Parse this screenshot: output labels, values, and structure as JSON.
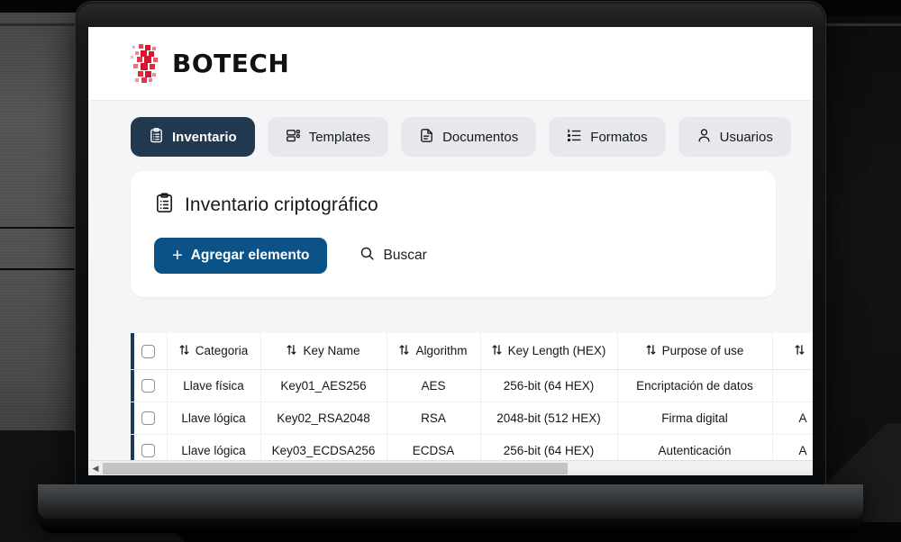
{
  "brand": {
    "name": "BOTECH",
    "mark_color": "#d8152f"
  },
  "nav": {
    "tabs": [
      {
        "label": "Inventario",
        "icon": "clipboard-icon",
        "active": true
      },
      {
        "label": "Templates",
        "icon": "layout-template-icon",
        "active": false
      },
      {
        "label": "Documentos",
        "icon": "document-icon",
        "active": false
      },
      {
        "label": "Formatos",
        "icon": "list-icon",
        "active": false
      },
      {
        "label": "Usuarios",
        "icon": "user-icon",
        "active": false
      }
    ]
  },
  "panel": {
    "title": "Inventario criptográfico",
    "title_icon": "clipboard-list-icon",
    "add_button": {
      "label": "Agregar elemento",
      "icon": "plus-icon",
      "color": "#0b5288"
    },
    "search_button": {
      "label": "Buscar",
      "icon": "search-icon"
    }
  },
  "table": {
    "select_all_checkbox": false,
    "columns": [
      {
        "label": "Categoria",
        "sortable": true
      },
      {
        "label": "Key Name",
        "sortable": true
      },
      {
        "label": "Algorithm",
        "sortable": true
      },
      {
        "label": "Key Length (HEX)",
        "sortable": true
      },
      {
        "label": "Purpose of use",
        "sortable": true
      },
      {
        "label": "",
        "sortable": true
      }
    ],
    "rows": [
      {
        "checked": false,
        "categoria": "Llave física",
        "key_name": "Key01_AES256",
        "algorithm": "AES",
        "key_length": "256-bit (64 HEX)",
        "purpose": "Encriptación de datos",
        "extra": ""
      },
      {
        "checked": false,
        "categoria": "Llave lógica",
        "key_name": "Key02_RSA2048",
        "algorithm": "RSA",
        "key_length": "2048-bit (512 HEX)",
        "purpose": "Firma digital",
        "extra": "A"
      },
      {
        "checked": false,
        "categoria": "Llave lógica",
        "key_name": "Key03_ECDSA256",
        "algorithm": "ECDSA",
        "key_length": "256-bit (64 HEX)",
        "purpose": "Autenticación",
        "extra": "A"
      }
    ]
  },
  "scrollbar": {
    "left_arrow": "◀",
    "orientation": "horizontal"
  },
  "theme": {
    "active_tab_bg": "#22384e",
    "tab_bg": "#e7e8ec",
    "page_bg": "#f4f5f7",
    "row_accent": "#1d3a5c"
  }
}
